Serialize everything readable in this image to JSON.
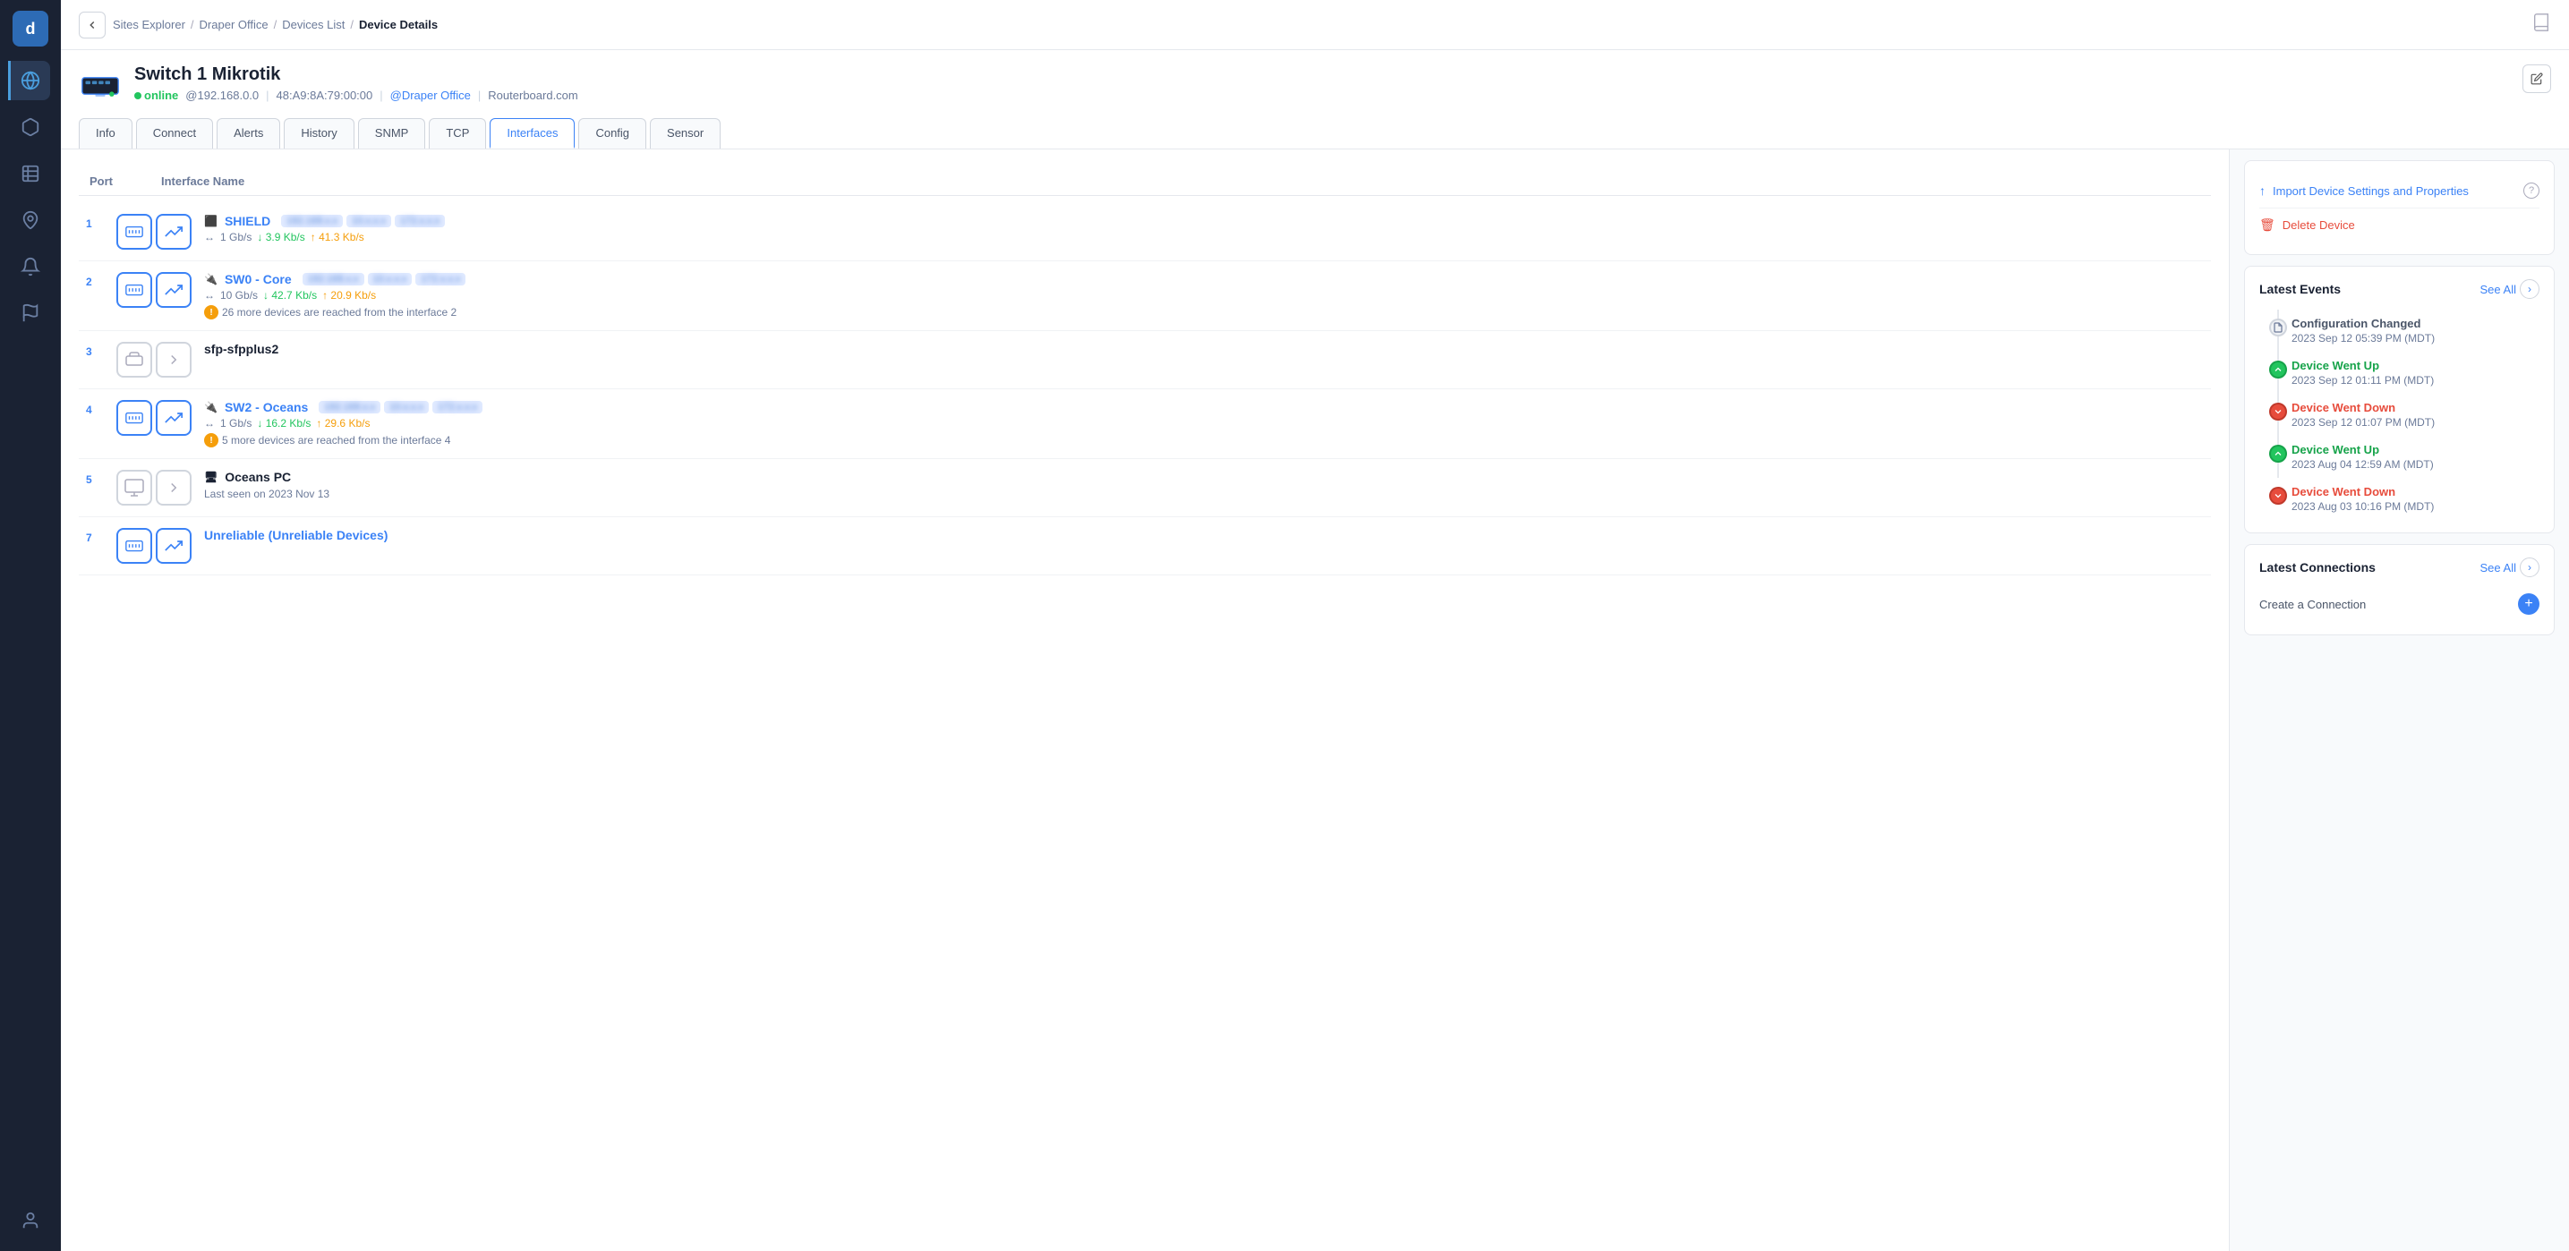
{
  "app": {
    "logo": "d",
    "logo_bg": "#2d6bb5"
  },
  "sidebar": {
    "items": [
      {
        "id": "globe",
        "label": "Network",
        "icon": "globe",
        "active": true
      },
      {
        "id": "cube",
        "label": "Devices",
        "icon": "cube",
        "active": false
      },
      {
        "id": "list",
        "label": "Reports",
        "icon": "list",
        "active": false
      },
      {
        "id": "map",
        "label": "Map",
        "icon": "map",
        "active": false
      },
      {
        "id": "bell",
        "label": "Alerts",
        "icon": "bell",
        "active": false
      },
      {
        "id": "flag",
        "label": "Issues",
        "icon": "flag",
        "active": false
      },
      {
        "id": "user",
        "label": "Account",
        "icon": "user",
        "active": false
      }
    ]
  },
  "breadcrumb": {
    "items": [
      {
        "label": "Sites Explorer",
        "active": false
      },
      {
        "label": "Draper Office",
        "active": false
      },
      {
        "label": "Devices List",
        "active": false
      },
      {
        "label": "Device Details",
        "active": true
      }
    ]
  },
  "device": {
    "name": "Switch 1 Mikrotik",
    "status": "online",
    "ip": "@192.168.0.0",
    "mac": "48:A9:8A:79:00:00",
    "site_link": "@Draper Office",
    "vendor": "Routerboard.com"
  },
  "tabs": [
    {
      "id": "info",
      "label": "Info",
      "active": false
    },
    {
      "id": "connect",
      "label": "Connect",
      "active": false
    },
    {
      "id": "alerts",
      "label": "Alerts",
      "active": false
    },
    {
      "id": "history",
      "label": "History",
      "active": false
    },
    {
      "id": "snmp",
      "label": "SNMP",
      "active": false
    },
    {
      "id": "tcp",
      "label": "TCP",
      "active": false
    },
    {
      "id": "interfaces",
      "label": "Interfaces",
      "active": true
    },
    {
      "id": "config",
      "label": "Config",
      "active": false
    },
    {
      "id": "sensor",
      "label": "Sensor",
      "active": false
    }
  ],
  "interfaces": {
    "columns": {
      "port": "Port",
      "name": "Interface Name"
    },
    "rows": [
      {
        "port": "1",
        "name": "SHIELD",
        "ip_pills": [
          "192.168.x.x",
          "10.x.x.x",
          "172.x.x.x"
        ],
        "speed": "1 Gb/s",
        "down": "3.9 Kb/s",
        "up": "41.3 Kb/s",
        "note": null,
        "type": "switch",
        "has_chart": true
      },
      {
        "port": "2",
        "name": "SW0 - Core",
        "ip_pills": [
          "192.168.x.x",
          "10.x.x.x",
          "172.x.x.x"
        ],
        "speed": "10 Gb/s",
        "down": "42.7 Kb/s",
        "up": "20.9 Kb/s",
        "note": "26 more devices are reached from the interface 2",
        "type": "switch",
        "has_chart": true
      },
      {
        "port": "3",
        "name": "sfp-sfpplus2",
        "ip_pills": [],
        "speed": null,
        "down": null,
        "up": null,
        "note": null,
        "type": "sfp",
        "has_chart": false
      },
      {
        "port": "4",
        "name": "SW2 - Oceans",
        "ip_pills": [
          "192.168.x.x",
          "10.x.x.x",
          "172.x.x.x"
        ],
        "speed": "1 Gb/s",
        "down": "16.2 Kb/s",
        "up": "29.6 Kb/s",
        "note": "5 more devices are reached from the interface 4",
        "type": "switch",
        "has_chart": true
      },
      {
        "port": "5",
        "name": "Oceans PC",
        "ip_pills": [],
        "speed": null,
        "down": null,
        "up": null,
        "note": "Last seen on 2023 Nov 13",
        "type": "pc",
        "has_chart": false
      },
      {
        "port": "7",
        "name": "Unreliable (Unreliable Devices)",
        "ip_pills": [],
        "speed": null,
        "down": null,
        "up": null,
        "note": null,
        "type": "switch",
        "has_chart": true
      }
    ]
  },
  "right_panel": {
    "actions": [
      {
        "id": "import",
        "label": "Import Device Settings and Properties",
        "icon": "↑",
        "type": "action"
      },
      {
        "id": "delete",
        "label": "Delete Device",
        "icon": "🗑",
        "type": "danger"
      }
    ],
    "latest_events": {
      "title": "Latest Events",
      "see_all": "See All",
      "events": [
        {
          "id": "config-changed",
          "name": "Configuration Changed",
          "time": "2023 Sep 12 05:39 PM (MDT)",
          "type": "neutral"
        },
        {
          "id": "went-up-1",
          "name": "Device Went Up",
          "time": "2023 Sep 12 01:11 PM (MDT)",
          "type": "up"
        },
        {
          "id": "went-down-1",
          "name": "Device Went Down",
          "time": "2023 Sep 12 01:07 PM (MDT)",
          "type": "down"
        },
        {
          "id": "went-up-2",
          "name": "Device Went Up",
          "time": "2023 Aug 04 12:59 AM (MDT)",
          "type": "up"
        },
        {
          "id": "went-down-2",
          "name": "Device Went Down",
          "time": "2023 Aug 03 10:16 PM (MDT)",
          "type": "down"
        }
      ]
    },
    "latest_connections": {
      "title": "Latest Connections",
      "see_all": "See All",
      "create_label": "Create a Connection",
      "create_icon": "+"
    }
  }
}
